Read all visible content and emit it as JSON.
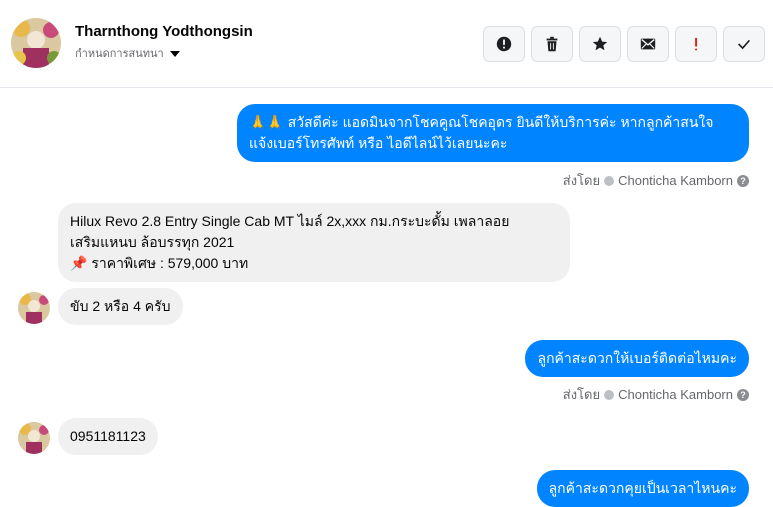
{
  "header": {
    "contact_name": "Tharnthong Yodthongsin",
    "label_selector": "กำหนดการสนทนา",
    "actions": [
      {
        "name": "report-icon",
        "color": "#1c1e21"
      },
      {
        "name": "trash-icon",
        "color": "#1c1e21"
      },
      {
        "name": "star-icon",
        "color": "#1c1e21"
      },
      {
        "name": "mail-icon",
        "color": "#1c1e21"
      },
      {
        "name": "important-icon",
        "color": "#e02020"
      },
      {
        "name": "check-icon",
        "color": "#1c1e21"
      }
    ]
  },
  "messages": {
    "m1": {
      "line1": "🙏🙏 สวัสดีค่ะ แอดมินจากโชคคูณโชคอุดร ยินดีให้บริการค่ะ หากลูกค้าสนใจ",
      "line2": "แจ้งเบอร์โทรศัพท์ หรือ ไอดีไลน์ไว้เลยนะคะ"
    },
    "sent_by_1": {
      "prefix": "ส่งโดย",
      "name": "Chonticha Kamborn"
    },
    "m2": {
      "line1": "Hilux Revo 2.8 Entry Single Cab MT ไมล์ 2x,xxx กม.กระบะดั้ม เพลาลอย",
      "line2": "เสริมแหนบ ล้อบรรทุก 2021",
      "line3": "📌 ราคาพิเศษ : 579,000 บาท"
    },
    "m3": {
      "text": "ขับ 2 หรือ 4 ครับ"
    },
    "m4": {
      "text": "ลูกค้าสะดวกให้เบอร์ติดต่อไหมคะ"
    },
    "sent_by_2": {
      "prefix": "ส่งโดย",
      "name": "Chonticha Kamborn"
    },
    "m5": {
      "text": "0951181123"
    },
    "m6": {
      "text": "ลูกค้าสะดวกคุยเป็นเวลาไหนคะ"
    }
  },
  "colors": {
    "outgoing": "#0084ff",
    "incoming": "#f0f0f0"
  }
}
